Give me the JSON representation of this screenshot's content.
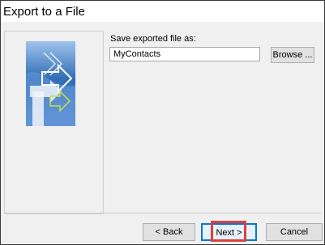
{
  "window": {
    "title": "Export to a File"
  },
  "form": {
    "save_label": "Save exported file as:",
    "filename_value": "MyContacts",
    "browse_label": "Browse ..."
  },
  "buttons": {
    "back_label": "< Back",
    "next_label": "Next >",
    "cancel_label": "Cancel"
  },
  "colors": {
    "accent": "#0078d7",
    "highlight": "#e0403a",
    "graphic_blue": "#2f6db5"
  },
  "icons": {
    "wizard_graphic": "export-arrows-graphic"
  }
}
